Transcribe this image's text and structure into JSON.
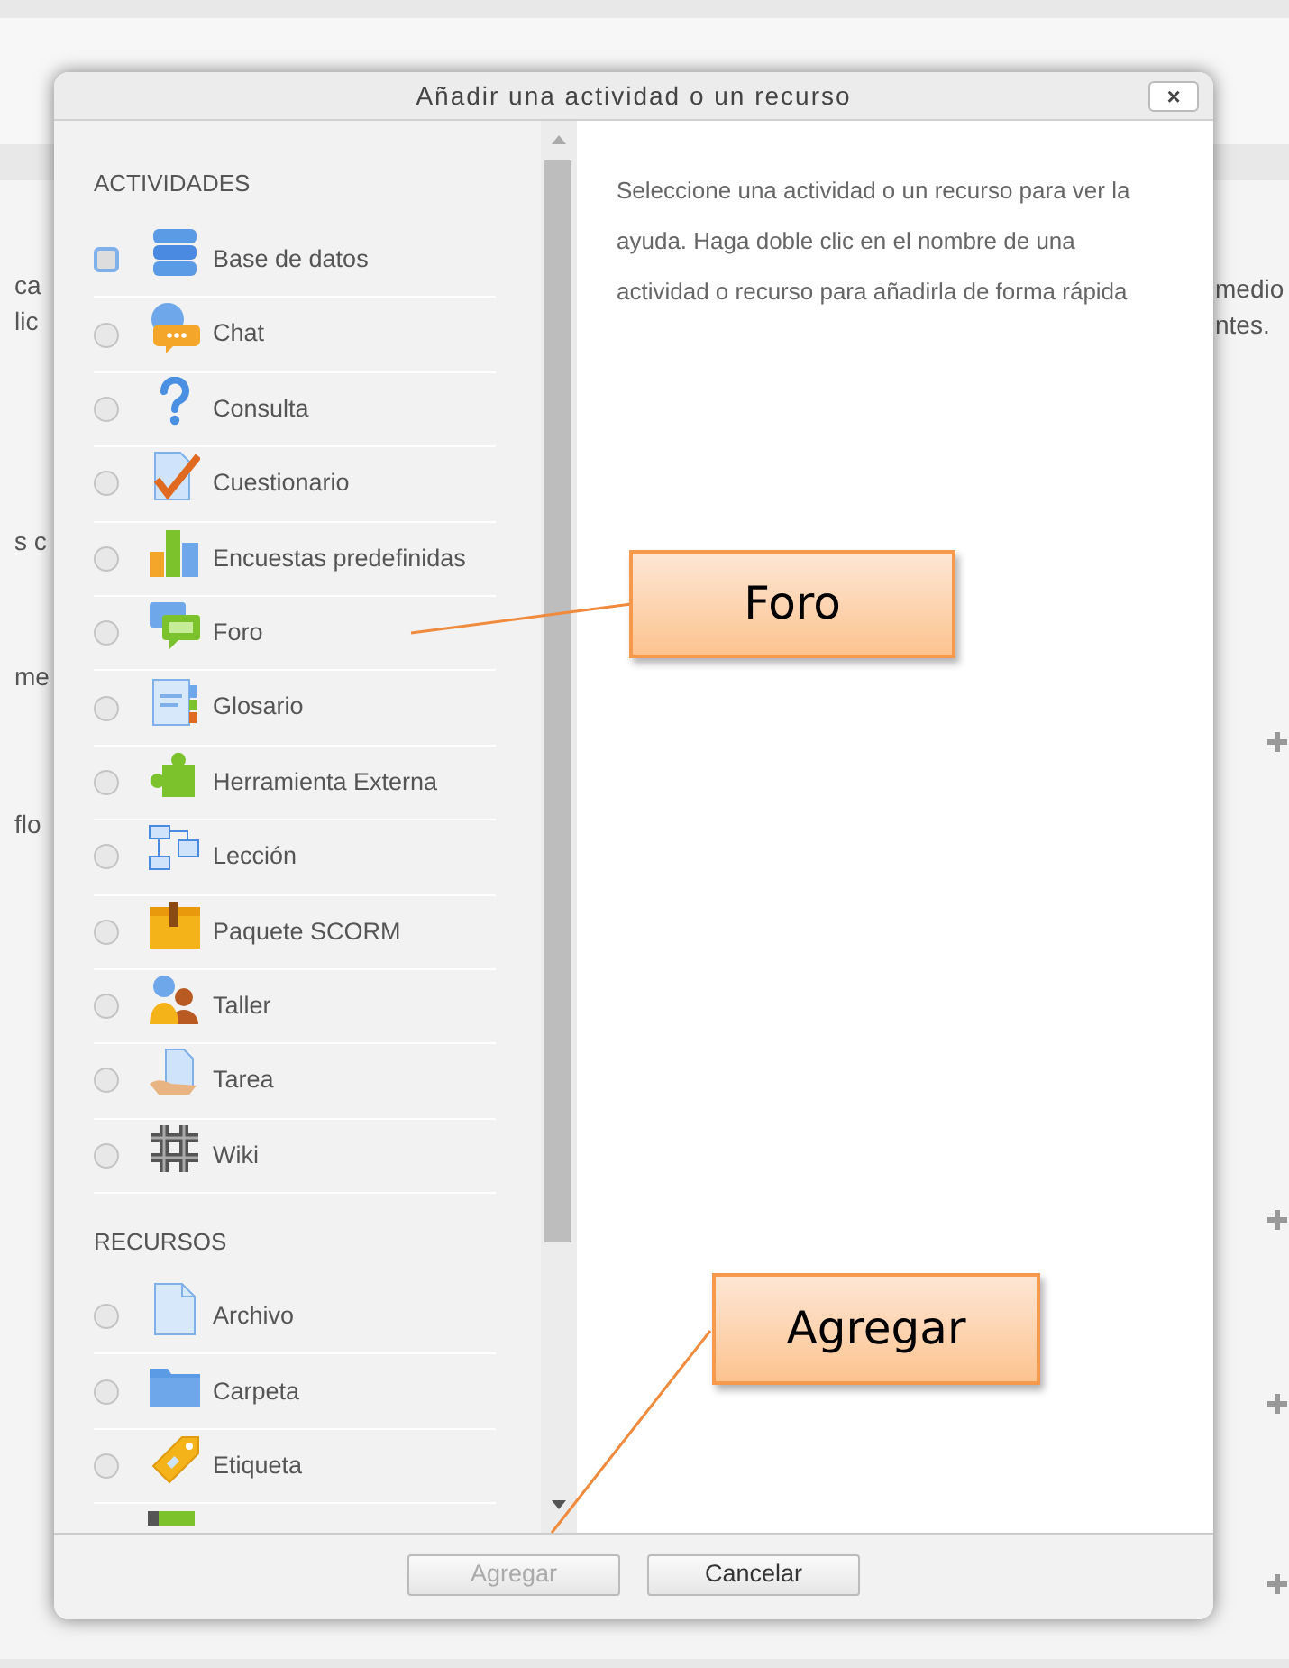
{
  "background": {
    "fragments_left": [
      "ca",
      "lic",
      "s c",
      "me",
      "flo"
    ],
    "fragments_right": [
      "medio",
      "ntes."
    ]
  },
  "dialog": {
    "title": "Añadir una actividad o un recurso",
    "close_label": "×",
    "sections": [
      {
        "heading": "ACTIVIDADES",
        "items": [
          {
            "label": "Base de datos",
            "focused": true
          },
          {
            "label": "Chat",
            "focused": false
          },
          {
            "label": "Consulta",
            "focused": false
          },
          {
            "label": "Cuestionario",
            "focused": false
          },
          {
            "label": "Encuestas predefinidas",
            "focused": false
          },
          {
            "label": "Foro",
            "focused": false
          },
          {
            "label": "Glosario",
            "focused": false
          },
          {
            "label": "Herramienta Externa",
            "focused": false
          },
          {
            "label": "Lección",
            "focused": false
          },
          {
            "label": "Paquete SCORM",
            "focused": false
          },
          {
            "label": "Taller",
            "focused": false
          },
          {
            "label": "Tarea",
            "focused": false
          },
          {
            "label": "Wiki",
            "focused": false
          }
        ]
      },
      {
        "heading": "RECURSOS",
        "items": [
          {
            "label": "Archivo",
            "focused": false
          },
          {
            "label": "Carpeta",
            "focused": false
          },
          {
            "label": "Etiqueta",
            "focused": false
          }
        ]
      }
    ],
    "help_text": "Seleccione una actividad o un recurso para ver la ayuda. Haga doble clic en el nombre de una actividad o recurso para añadirla de forma rápida",
    "buttons": [
      {
        "label": "Agregar",
        "disabled": true
      },
      {
        "label": "Cancelar",
        "disabled": false
      }
    ]
  },
  "callouts": [
    {
      "text": "Foro"
    },
    {
      "text": "Agregar"
    }
  ]
}
